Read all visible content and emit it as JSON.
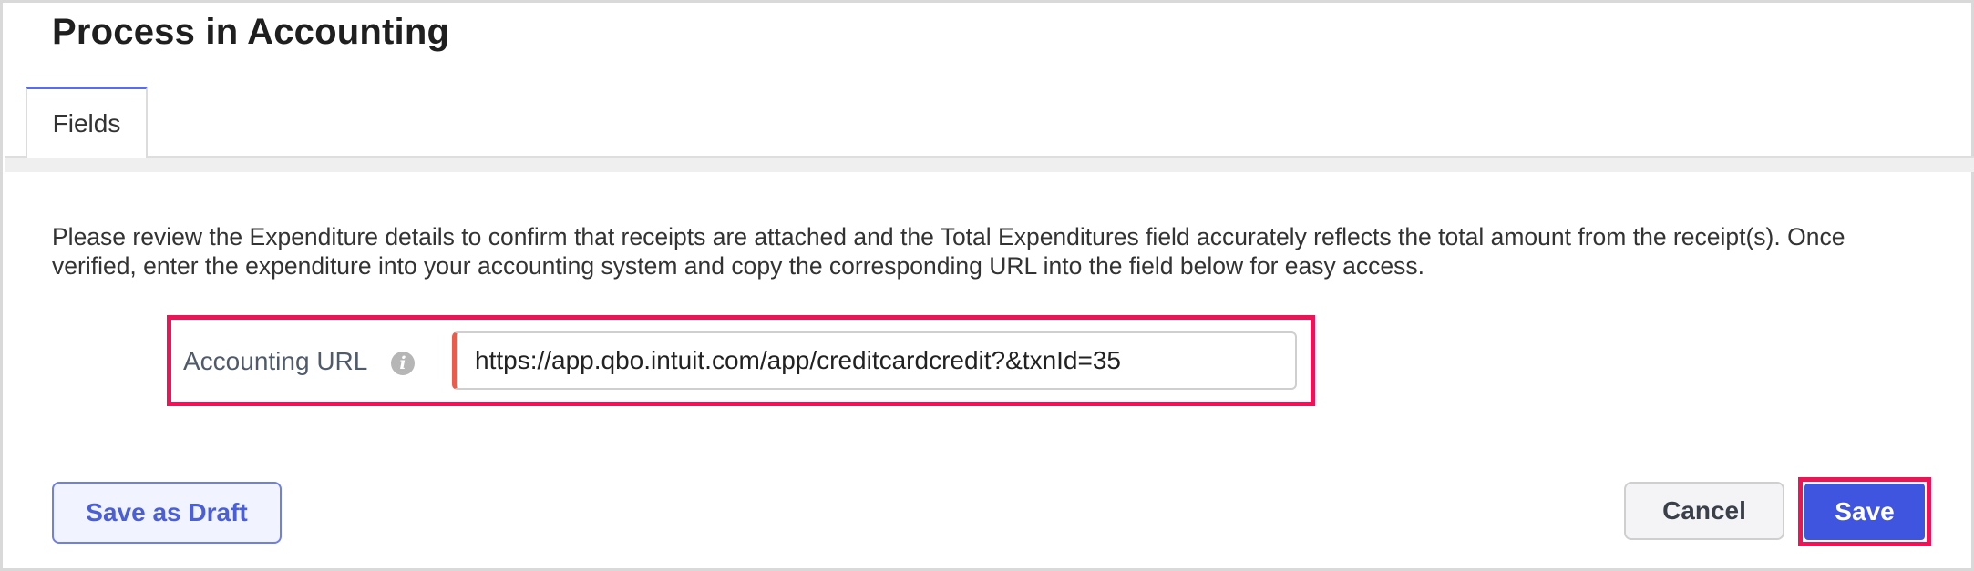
{
  "header": {
    "title": "Process in Accounting"
  },
  "tabs": [
    {
      "label": "Fields",
      "active": true
    }
  ],
  "form": {
    "description": "Please review the Expenditure details to confirm that receipts are attached and the Total Expenditures field accurately reflects the total amount from the receipt(s). Once verified, enter the expenditure into your accounting system and copy the corresponding URL into the field below for easy access.",
    "accounting_url": {
      "label": "Accounting URL",
      "info_icon": "info-icon",
      "value": "https://app.qbo.intuit.com/app/creditcardcredit?&txnId=35"
    }
  },
  "actions": {
    "save_draft_label": "Save as Draft",
    "cancel_label": "Cancel",
    "save_label": "Save"
  },
  "colors": {
    "accent": "#3f55e0",
    "highlight": "#ee1356",
    "required_marker": "#ef5a4a"
  }
}
